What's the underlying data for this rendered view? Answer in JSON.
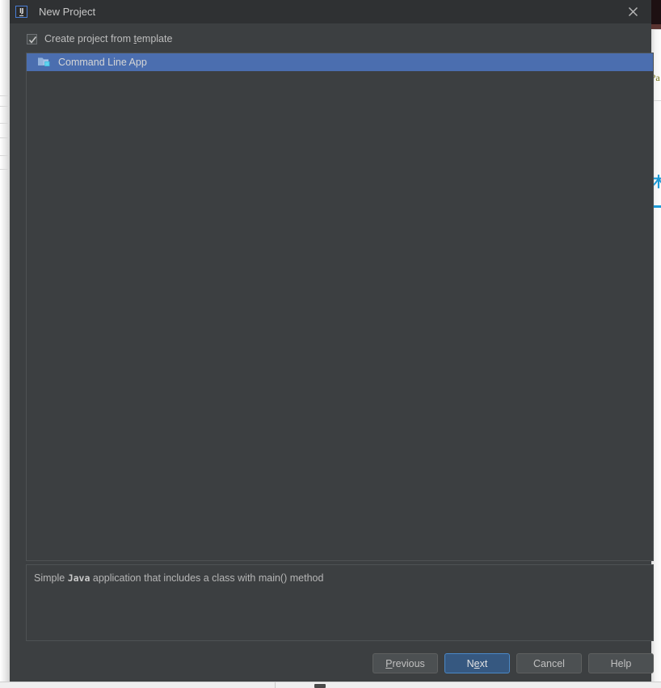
{
  "dialog": {
    "title": "New Project",
    "logo_text": "IJ",
    "logo_icon": "intellij-idea-icon",
    "close_icon": "close-icon"
  },
  "options": {
    "create_from_template": {
      "label_before": "Create project from ",
      "mnemonic": "t",
      "label_after": "emplate",
      "checked": true
    }
  },
  "template_list": {
    "items": [
      {
        "label": "Command Line App",
        "icon": "folder-module-icon",
        "selected": true
      }
    ]
  },
  "description": {
    "text_before": "Simple ",
    "emphasis": "Java",
    "text_after": " application that includes a class with main() method"
  },
  "buttons": {
    "previous": {
      "mnemonic": "P",
      "rest": "revious"
    },
    "next": {
      "before": "N",
      "mnemonic": "e",
      "after": "xt",
      "default": true
    },
    "cancel": {
      "label": "Cancel"
    },
    "help": {
      "label": "Help"
    }
  },
  "colors": {
    "dialog_bg": "#3c3f41",
    "titlebar_bg": "#2f3133",
    "selection_blue": "#4b6eaf",
    "default_button_blue": "#365880",
    "accent_cyan": "#1b9ad6"
  },
  "background": {
    "right_glyph": "木",
    "right_question": "?a"
  }
}
